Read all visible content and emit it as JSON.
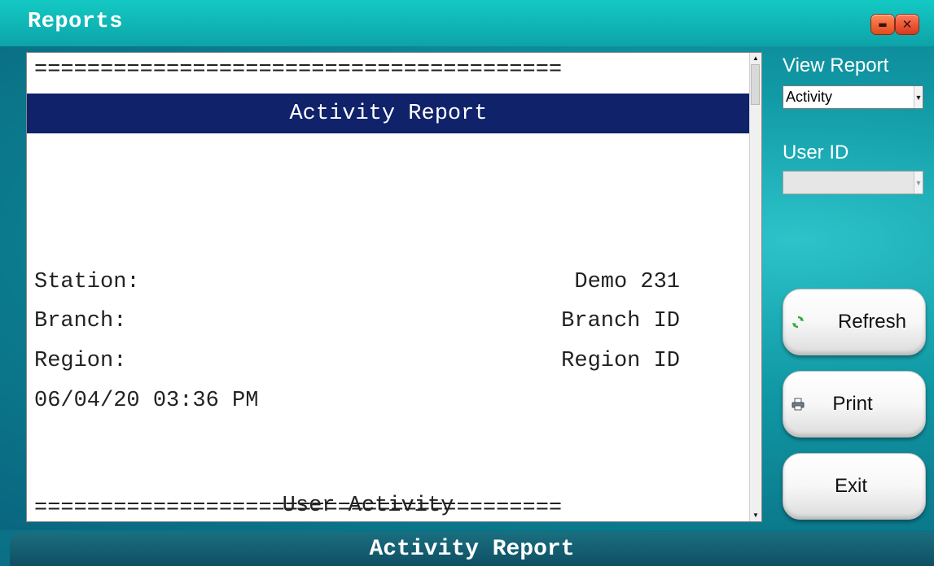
{
  "window": {
    "title": "Reports",
    "minimize_symbol": "▬",
    "close_symbol": "✕"
  },
  "report": {
    "rule": "========================================",
    "banner_title": "Activity Report",
    "fields": [
      {
        "label": "Station:",
        "value": "Demo 231"
      },
      {
        "label": "Branch:",
        "value": "Branch ID"
      },
      {
        "label": "Region:",
        "value": "Region ID"
      }
    ],
    "timestamp": "06/04/20 03:36 PM",
    "section_title": "User Activity"
  },
  "sidebar": {
    "view_report_label": "View Report",
    "view_report_value": "Activity",
    "user_id_label": "User ID",
    "user_id_value": "",
    "refresh_label": "Refresh",
    "refresh_icon": "refresh-icon",
    "print_label": "Print",
    "print_icon": "printer-icon",
    "exit_label": "Exit"
  },
  "status": {
    "text": "Activity Report"
  },
  "colors": {
    "accent": "#10226a",
    "title_bar": "#14c9c4",
    "status_bar": "#0f4f63"
  }
}
